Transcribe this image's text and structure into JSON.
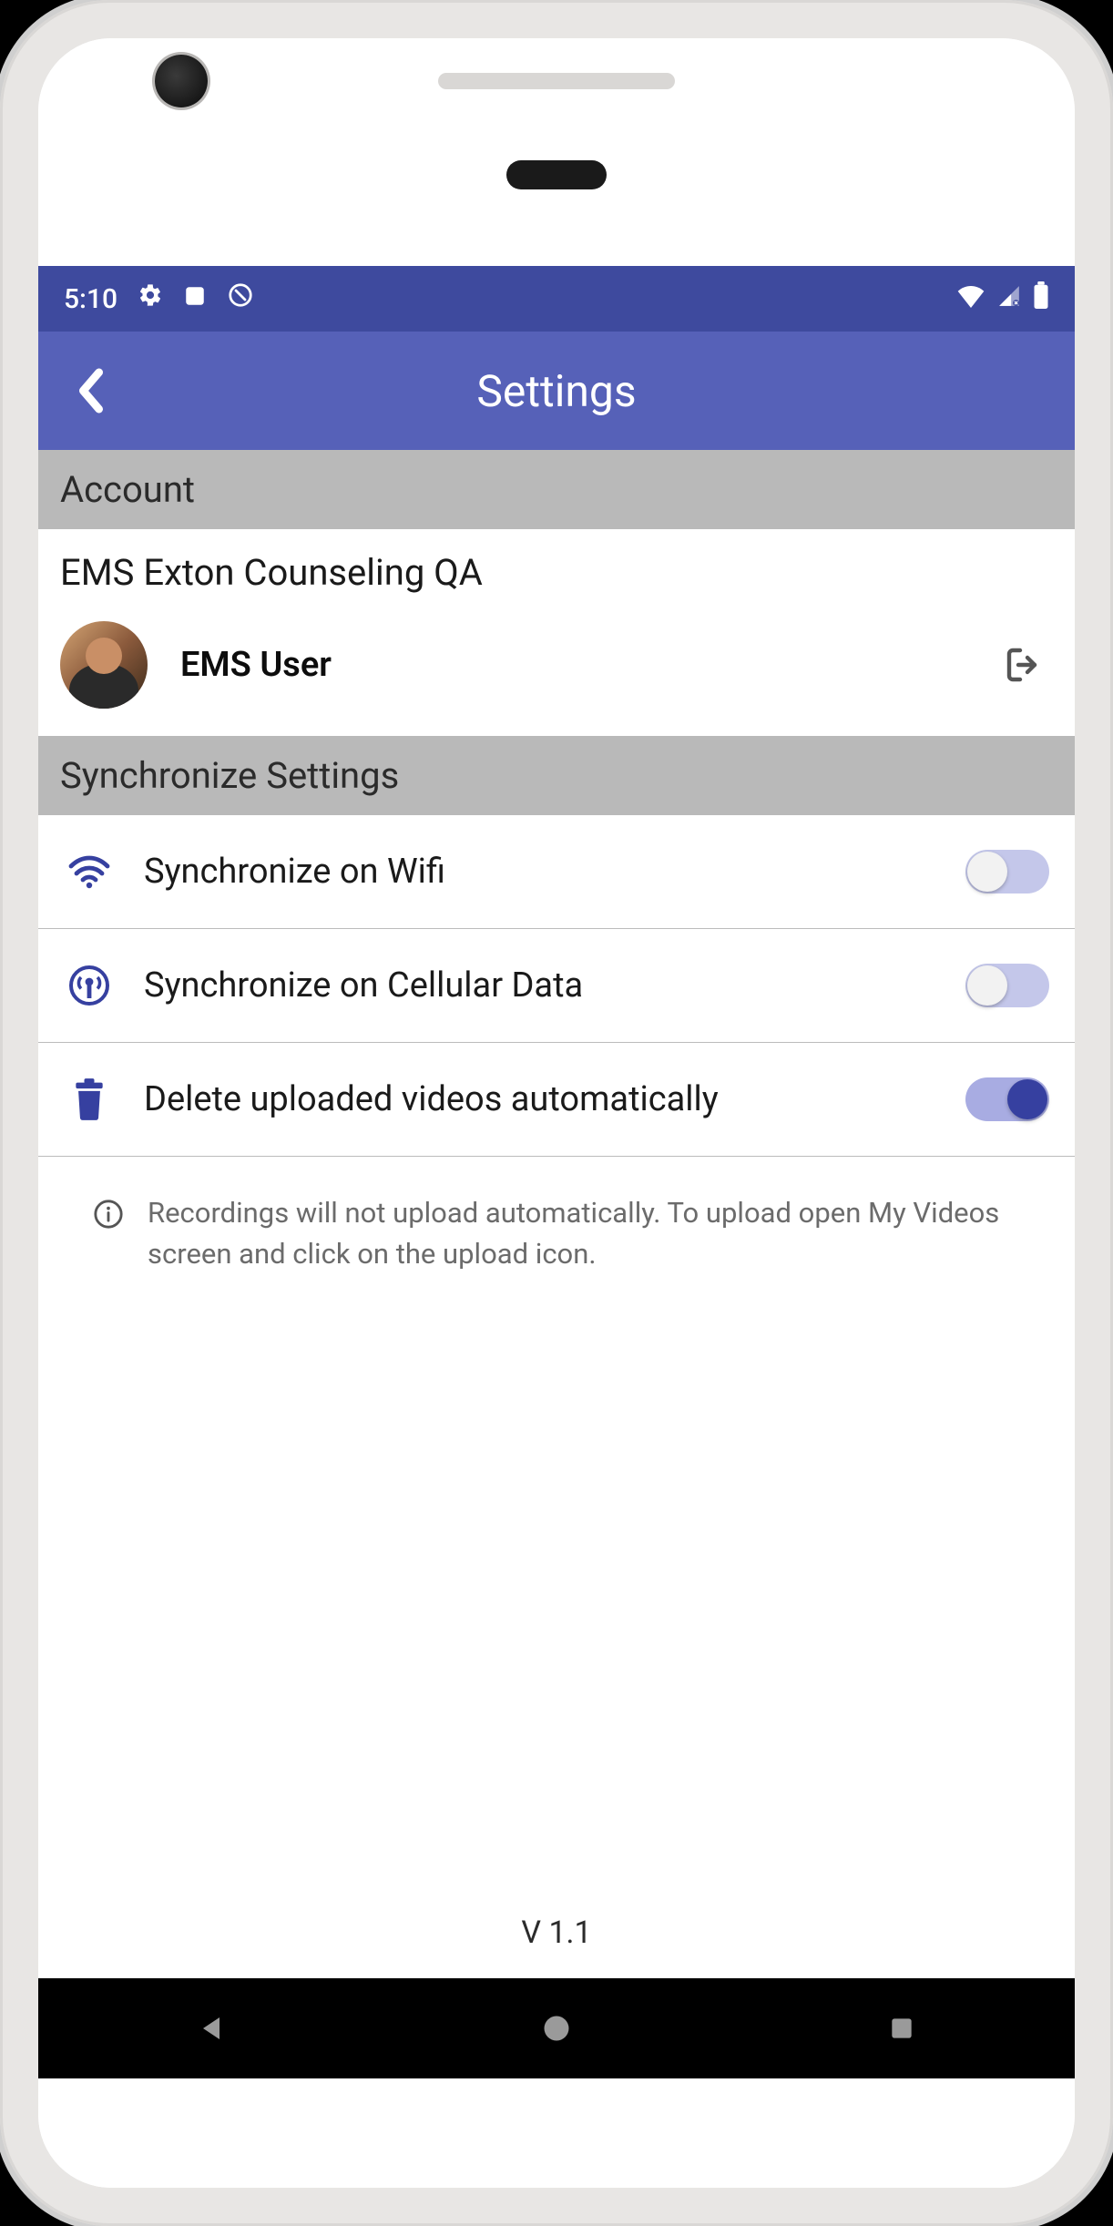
{
  "statusBar": {
    "time": "5:10"
  },
  "appBar": {
    "title": "Settings"
  },
  "sections": {
    "account": {
      "header": "Account",
      "org": "EMS Exton Counseling QA",
      "user": "EMS User"
    },
    "sync": {
      "header": "Synchronize Settings",
      "items": [
        {
          "label": "Synchronize on Wifi",
          "enabled": false
        },
        {
          "label": "Synchronize on Cellular Data",
          "enabled": false
        },
        {
          "label": "Delete uploaded videos automatically",
          "enabled": true
        }
      ],
      "info": "Recordings will not upload automatically. To upload open My Videos screen and click on the upload icon."
    }
  },
  "version": "V 1.1"
}
